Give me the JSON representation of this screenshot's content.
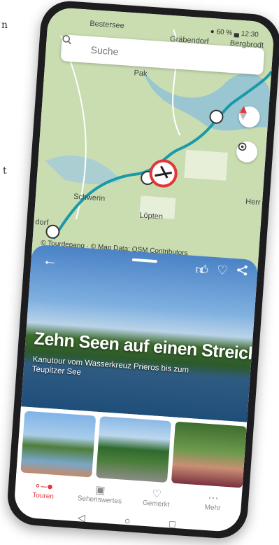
{
  "page_fragments": {
    "left_n": "n",
    "left_t": "t"
  },
  "status_bar": {
    "text": "● 60 % ▄ 12:30"
  },
  "search": {
    "placeholder": "Suche"
  },
  "map": {
    "labels": [
      "Bestersee",
      "Gräbendorf",
      "Bergbrodt",
      "Pak",
      "Schwerin",
      "Löpten",
      "dorf",
      "Herr"
    ],
    "attribution": "© Tourdepang · © Map Data: OSM Contributors",
    "route_color": "#1a9aa8",
    "marker_color": "#e0373a"
  },
  "tour": {
    "back_icon": "back-arrow-icon",
    "like_count": "1",
    "title": "Zehn Seen auf einen Streich",
    "subtitle": "Kanutour vom Wasserkreuz Prieros bis zum Teupitzer See"
  },
  "bottom_nav": [
    {
      "label": "Touren",
      "icon": "route-icon",
      "active": true
    },
    {
      "label": "Sehenswertes",
      "icon": "gallery-icon",
      "active": false
    },
    {
      "label": "Gemerkt",
      "icon": "heart-icon",
      "active": false
    },
    {
      "label": "Mehr",
      "icon": "more-icon",
      "active": false
    }
  ],
  "system_nav": [
    "◁",
    "○",
    "□"
  ],
  "colors": {
    "accent": "#e0373a",
    "map_green": "#c8dcae",
    "water": "#a9c9e6"
  }
}
